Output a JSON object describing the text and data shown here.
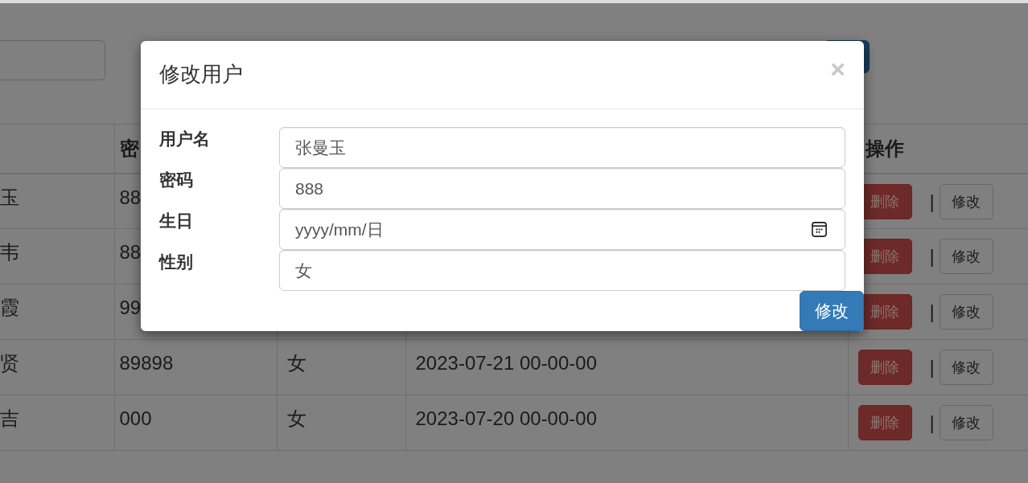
{
  "table": {
    "header": {
      "column_2": "密",
      "column_5": "操作"
    },
    "rows": [
      {
        "column_1": "玉",
        "column_2": "88",
        "actions": [
          {
            "kind": "danger",
            "label": "删除"
          },
          {
            "kind": "default",
            "label": "修改"
          }
        ],
        "separator": "|"
      },
      {
        "column_1": "韦",
        "column_2": "88",
        "actions": [
          {
            "kind": "danger",
            "label": "删除"
          },
          {
            "kind": "default",
            "label": "修改"
          }
        ],
        "separator": "|"
      },
      {
        "column_1": "霞",
        "column_2": "99",
        "actions": [
          {
            "kind": "danger",
            "label": "删除"
          },
          {
            "kind": "default",
            "label": "修改"
          }
        ],
        "separator": "|"
      },
      {
        "column_1": "贤",
        "column_2": "89898",
        "column_3": "女",
        "column_4": "2023-07-21 00-00-00",
        "actions": [
          {
            "kind": "danger",
            "label": "删除"
          },
          {
            "kind": "default",
            "label": "修改"
          }
        ],
        "separator": "|"
      },
      {
        "column_1": "吉",
        "column_2": "000",
        "column_3": "女",
        "column_4": "2023-07-20 00-00-00",
        "actions": [
          {
            "kind": "danger",
            "label": "删除"
          },
          {
            "kind": "default",
            "label": "修改"
          }
        ],
        "separator": "|"
      }
    ]
  },
  "modal": {
    "title": "修改用户",
    "close": "×",
    "fields": [
      {
        "kind": "text",
        "label": "用户名",
        "value": "张曼玉"
      },
      {
        "kind": "text",
        "label": "密码",
        "value": "888"
      },
      {
        "kind": "date",
        "label": "生日",
        "placeholder": "yyyy/mm/日"
      },
      {
        "kind": "text",
        "label": "性别",
        "value": "女"
      }
    ],
    "submit": "修改"
  }
}
